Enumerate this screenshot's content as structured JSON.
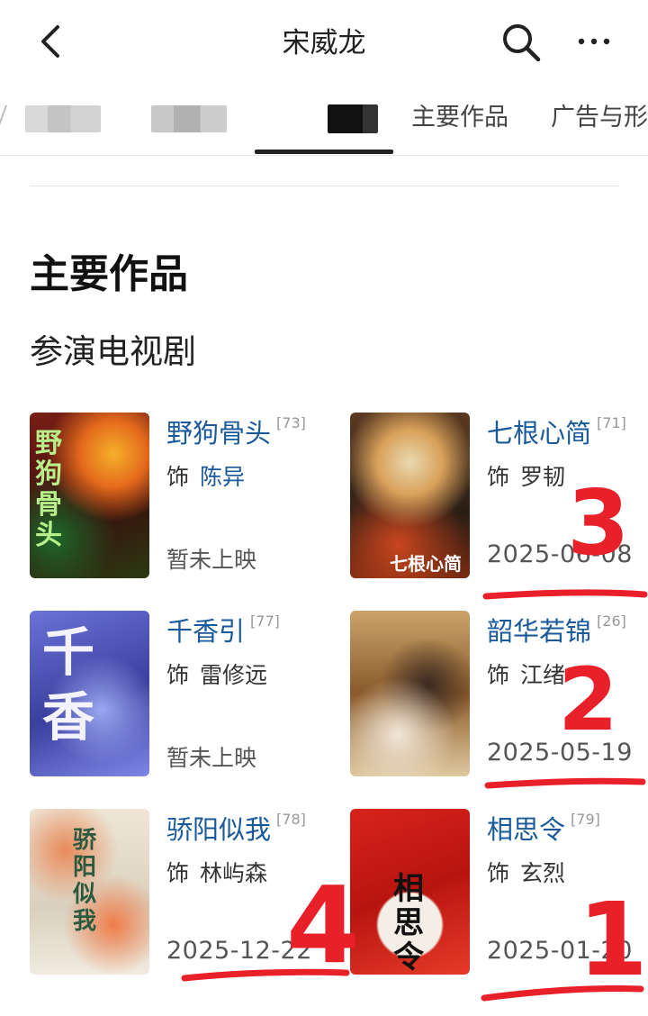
{
  "header": {
    "back_icon": "chevron-left-icon",
    "title": "宋威龙",
    "search_icon": "search-icon",
    "more_icon": "more-horizontal-icon"
  },
  "tabs": [
    {
      "label": "主要作品"
    },
    {
      "label": "广告与形"
    }
  ],
  "section": {
    "title": "主要作品",
    "subtitle": "参演电视剧"
  },
  "works": [
    {
      "title": "野狗骨头",
      "score": "[73]",
      "role_prefix": "饰",
      "role": "陈异",
      "status": "暂未上映",
      "poster_text": "野狗骨头"
    },
    {
      "title": "七根心简",
      "score": "[71]",
      "role_prefix": "饰",
      "role": "罗韧",
      "status": "2025-06-08",
      "poster_text": "七根心简"
    },
    {
      "title": "千香引",
      "score": "[77]",
      "role_prefix": "饰",
      "role": "雷修远",
      "status": "暂未上映",
      "poster_text": "千香"
    },
    {
      "title": "韶华若锦",
      "score": "[26]",
      "role_prefix": "饰",
      "role": "江绪",
      "status": "2025-05-19",
      "poster_text": ""
    },
    {
      "title": "骄阳似我",
      "score": "[78]",
      "role_prefix": "饰",
      "role": "林屿森",
      "status": "2025-12-22",
      "poster_text": "骄阳似我"
    },
    {
      "title": "相思令",
      "score": "[79]",
      "role_prefix": "饰",
      "role": "玄烈",
      "status": "2025-01-20",
      "poster_text": "相思令"
    }
  ],
  "annotations": [
    "3",
    "2",
    "4",
    "1"
  ],
  "colors": {
    "link": "#1a5a9a",
    "annotation": "#e8202a",
    "tab_underline": "#222222"
  }
}
